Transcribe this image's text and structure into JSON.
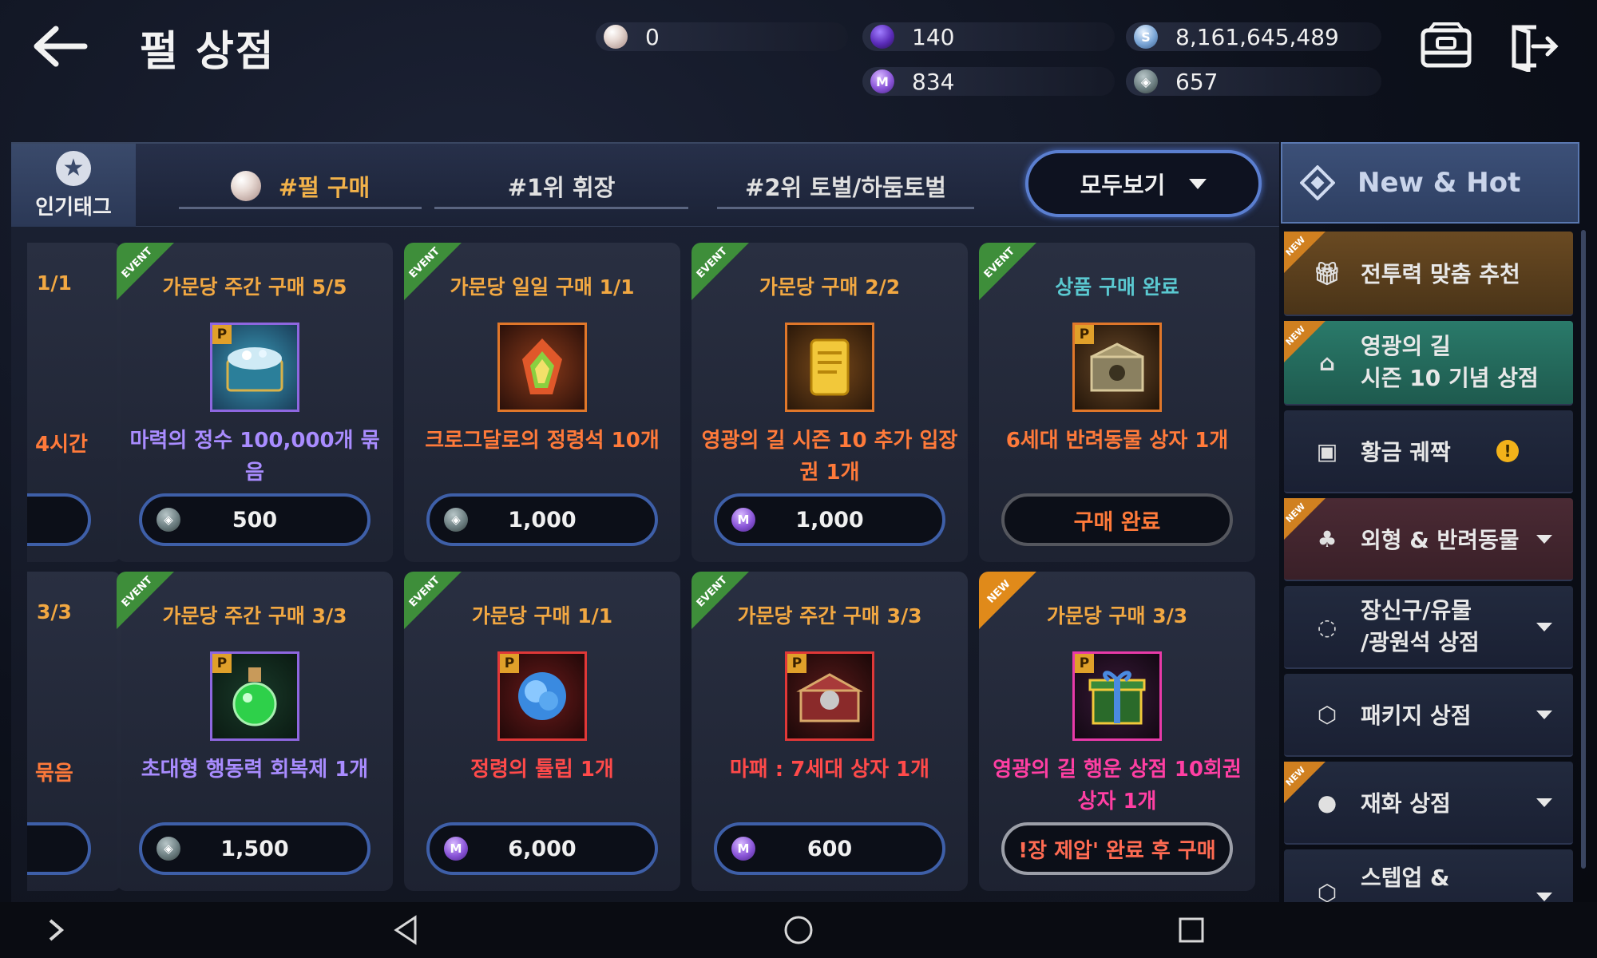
{
  "header": {
    "title": "펄 상점",
    "currencies": {
      "pearl": "0",
      "purple_gem": "140",
      "silver": "8,161,645,489",
      "mileage": "834",
      "guild_coin": "657"
    }
  },
  "tags": {
    "hot_label": "인기태그",
    "items": [
      "#펄 구매",
      "#1위 휘장",
      "#2위 토벌/하둠토벌"
    ],
    "view_all": "모두보기"
  },
  "partial_cards": [
    {
      "limit": "1/1",
      "name": "4시간"
    },
    {
      "limit": "3/3",
      "name": "묶음"
    }
  ],
  "products": [
    {
      "badge": "EVENT",
      "limit": "가문당 주간 구매 5/5",
      "name": "마력의 정수 100,000개 묶음",
      "price": "500",
      "currency": "guild_coin"
    },
    {
      "badge": "EVENT",
      "limit": "가문당 일일 구매 1/1",
      "name": "크로그달로의 정령석 10개",
      "price": "1,000",
      "currency": "guild_coin"
    },
    {
      "badge": "EVENT",
      "limit": "가문당 구매 2/2",
      "name": "영광의 길 시즌 10 추가 입장권 1개",
      "price": "1,000",
      "currency": "mileage"
    },
    {
      "badge": "EVENT",
      "limit": "상품 구매 완료",
      "name": "6세대 반려동물 상자 1개",
      "price": "구매 완료",
      "currency": "none"
    },
    {
      "badge": "EVENT",
      "limit": "가문당 주간 구매 3/3",
      "name": "초대형 행동력 회복제 1개",
      "price": "1,500",
      "currency": "guild_coin"
    },
    {
      "badge": "EVENT",
      "limit": "가문당 구매 1/1",
      "name": "정령의 튤립 1개",
      "price": "6,000",
      "currency": "mileage"
    },
    {
      "badge": "EVENT",
      "limit": "가문당 주간 구매 3/3",
      "name": "마패 : 7세대 상자 1개",
      "price": "600",
      "currency": "mileage"
    },
    {
      "badge": "NEW",
      "limit": "가문당 구매 3/3",
      "name": "영광의 길 행운 상점 10회권 상자 1개",
      "price": "!장 제압' 완료 후 구매",
      "currency": "none"
    }
  ],
  "sidebar": {
    "header": "New & Hot",
    "items": [
      {
        "label": "전투력 맞춤 추천",
        "new": true,
        "icon": "gift-icon"
      },
      {
        "label": "영광의 길",
        "label2": "시즌 10 기념 상점",
        "new": true,
        "icon": "shop-icon"
      },
      {
        "label": "황금 궤짝",
        "new": false,
        "icon": "chest-icon"
      },
      {
        "label": "외형 & 반려동물",
        "new": true,
        "icon": "costume-icon"
      },
      {
        "label": "장신구/유물",
        "label2": "/광원석 상점",
        "new": false,
        "icon": "ring-icon"
      },
      {
        "label": "패키지 상점",
        "new": false,
        "icon": "package-icon"
      },
      {
        "label": "재화 상점",
        "new": true,
        "icon": "currency-icon"
      },
      {
        "label": "스텝업 &",
        "new": false,
        "icon": "stepup-icon"
      }
    ],
    "new_badge": "NEW",
    "alert": "!"
  },
  "colors": {
    "accent_blue": "#5b7fd0",
    "event_green": "#3e8e3a",
    "new_orange": "#e08a1a",
    "limit_orange": "#f2a842",
    "done_cyan": "#5ac8d0"
  }
}
